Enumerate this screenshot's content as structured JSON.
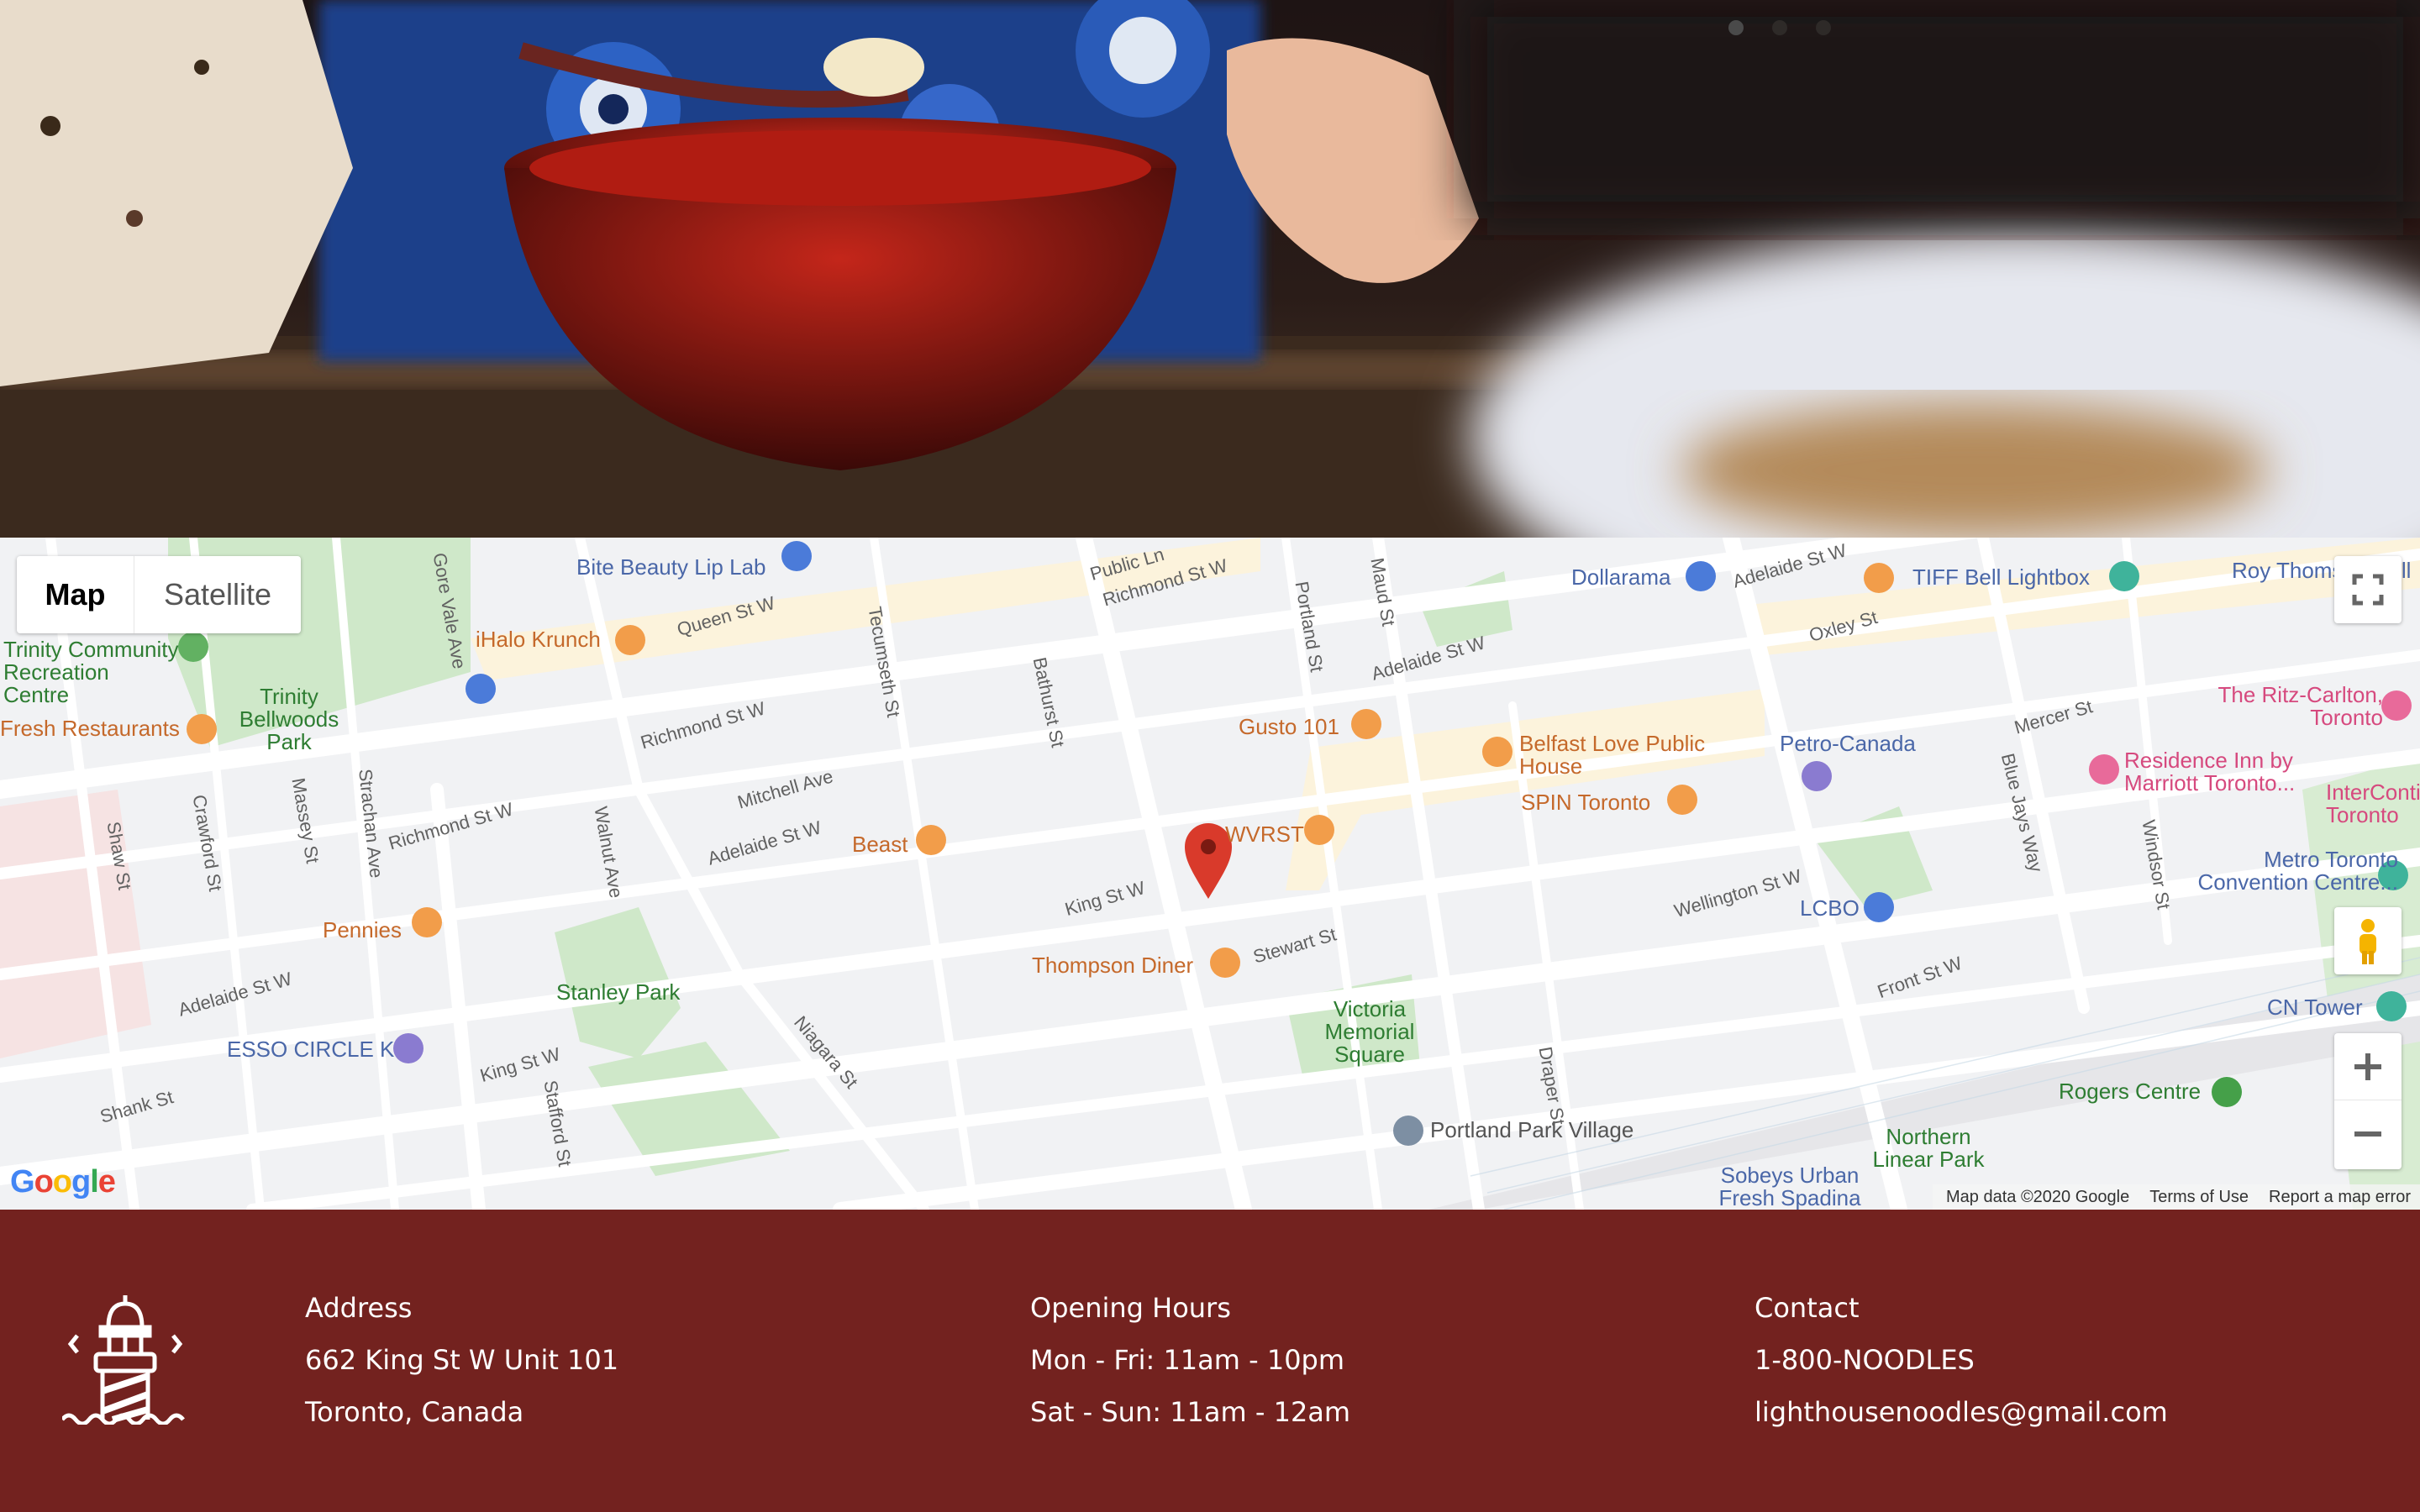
{
  "hero": {
    "carousel_dots": 3,
    "active_dot": 0
  },
  "map": {
    "type_control": {
      "map_label": "Map",
      "satellite_label": "Satellite",
      "selected": "Map"
    },
    "labels": {
      "bite_beauty": "Bite Beauty Lip Lab",
      "ihalo": "iHalo Krunch",
      "trinity": "Trinity Bellwoods Park",
      "rec_centre": "Trinity Community Recreation Centre",
      "fresh": "Fresh Restaurants",
      "gusto": "Gusto 101",
      "belfast": "Belfast Love Public House",
      "spin": "SPIN Toronto",
      "petro": "Petro-Canada",
      "dollarama": "Dollarama",
      "tiff": "TIFF Bell Lightbox",
      "roy": "Roy Thomson Hall",
      "ritz": "The Ritz-Carlton, Toronto",
      "residence": "Residence Inn by Marriott Toronto...",
      "intercon": "InterContinental Toronto",
      "metro": "Metro Toronto Convention Centre...",
      "cn": "CN Tower",
      "rogers": "Rogers Centre",
      "northern": "Northern Linear Park",
      "sobeys": "Sobeys Urban Fresh Spadina",
      "portland_village": "Portland Park Village",
      "victoria": "Victoria Memorial Square",
      "thompson": "Thompson Diner",
      "beast": "Beast",
      "wvrst": "WVRST",
      "pennies": "Pennies",
      "stanley": "Stanley Park",
      "esso": "ESSO CIRCLE K",
      "lcbo": "LCBO"
    },
    "streets": {
      "queen": "Queen St W",
      "richmond1": "Richmond St W",
      "richmond2": "Richmond St W",
      "richmond3": "Richmond St W",
      "adelaide1": "Adelaide St W",
      "adelaide2": "Adelaide St W",
      "adelaide3": "Adelaide St W",
      "adelaide4": "Adelaide St W",
      "king1": "King St W",
      "king2": "King St W",
      "wellington": "Wellington St W",
      "front": "Front St W",
      "bathurst": "Bathurst St",
      "strachan": "Strachan Ave",
      "shaw": "Shaw St",
      "niagara": "Niagara St",
      "portland": "Portland St",
      "tecumseth": "Tecumseth St",
      "mitchell": "Mitchell Ave",
      "stewart": "Stewart St",
      "bluejays": "Blue Jays Way",
      "gorevale": "Gore Vale Ave",
      "crawford": "Crawford St",
      "massey": "Massey St",
      "walnut": "Walnut Ave",
      "shank": "Shank St",
      "oxley": "Oxley St",
      "mercer": "Mercer St",
      "draper": "Draper St",
      "stafford": "Stafford St",
      "maud": "Maud St",
      "windsor": "Windsor St",
      "publicln": "Public Ln"
    },
    "attribution": {
      "map_data": "Map data ©2020 Google",
      "terms": "Terms of Use",
      "report": "Report a map error"
    },
    "logo": "Google",
    "marker_color": "#d93a2b"
  },
  "footer": {
    "background": "#73221f",
    "address": {
      "heading": "Address",
      "line1": "662 King St W Unit 101",
      "line2": "Toronto, Canada"
    },
    "hours": {
      "heading": "Opening Hours",
      "line1": "Mon - Fri: 11am - 10pm",
      "line2": "Sat - Sun: 11am - 12am"
    },
    "contact": {
      "heading": "Contact",
      "phone": "1-800-NOODLES",
      "email": "lighthousenoodles@gmail.com"
    }
  }
}
